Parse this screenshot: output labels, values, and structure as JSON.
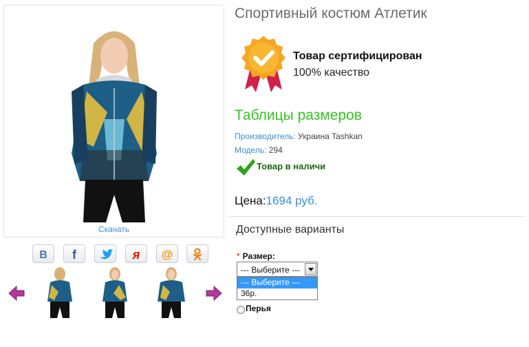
{
  "product": {
    "title": "Спортивный костюм Атлетик",
    "download_label": "Скачать",
    "certificate": {
      "title": "Товар сертифицирован",
      "subtitle": "100% качество",
      "icon": "certified-badge-icon"
    },
    "size_table_link": "Таблицы размеров",
    "specs": [
      {
        "label": "Производитель:",
        "value": "Украина Tashkan"
      },
      {
        "label": "Модель:",
        "value": "294"
      }
    ],
    "stock_status": "Товар в наличи",
    "price": {
      "label": "Цена:",
      "value": "1694 руб."
    }
  },
  "social": [
    {
      "name": "vk",
      "icon": "vk-icon",
      "letter": "В",
      "color": "#4a76a8"
    },
    {
      "name": "facebook",
      "icon": "facebook-icon",
      "letter": "f",
      "color": "#3b5998"
    },
    {
      "name": "twitter",
      "icon": "twitter-icon",
      "letter": "",
      "color": "#1da1f2"
    },
    {
      "name": "yandex",
      "icon": "yandex-icon",
      "letter": "я",
      "color": "#e61400"
    },
    {
      "name": "mail",
      "icon": "mail-ru-icon",
      "letter": "@",
      "color": "#f29400"
    },
    {
      "name": "odnoklassniki",
      "icon": "odnoklassniki-icon",
      "letter": "",
      "color": "#ee8208"
    }
  ],
  "thumbnails": {
    "prev_icon": "arrow-left-icon",
    "next_icon": "arrow-right-icon",
    "count": 3
  },
  "options": {
    "heading": "Доступные варианты",
    "size": {
      "required_mark": "*",
      "label": "Размер:",
      "selected": "--- Выберите ---",
      "items": [
        "--- Выберите ---",
        "36р."
      ]
    },
    "radio_label": "Перья"
  },
  "colors": {
    "accent_blue": "#3a8fd0",
    "link_green": "#36c420",
    "stock_green": "#176b0e",
    "select_highlight": "#3399ff"
  }
}
